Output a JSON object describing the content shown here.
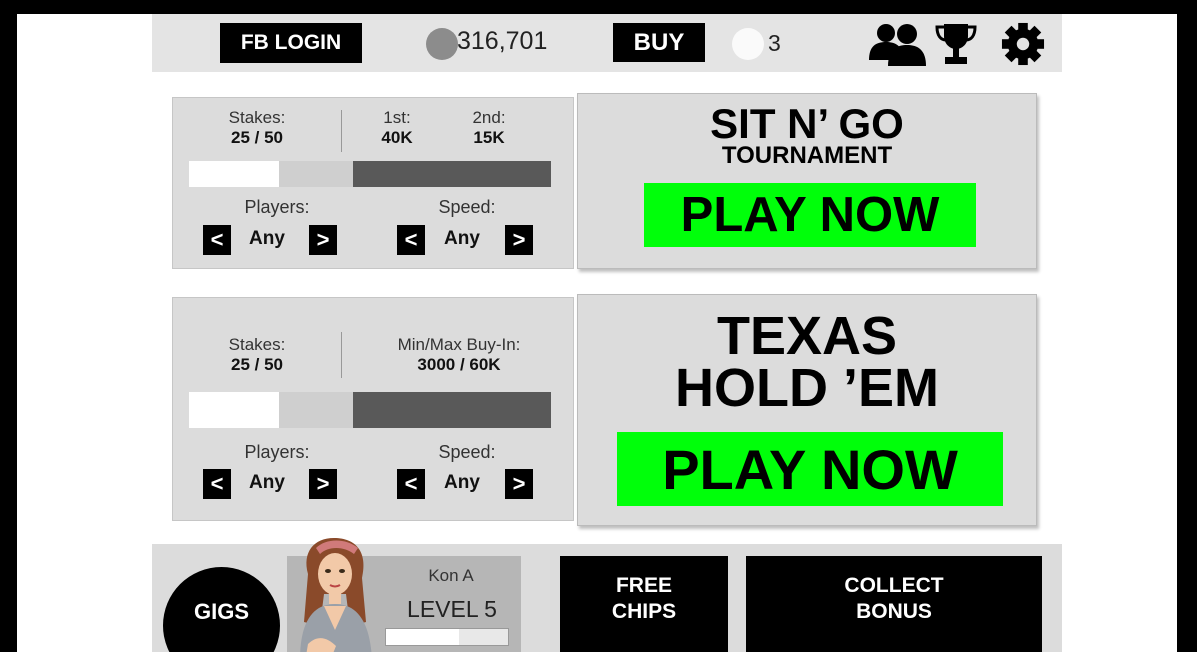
{
  "topbar": {
    "fb_login": "FB LOGIN",
    "chips": "316,701",
    "buy": "BUY",
    "tickets": "3",
    "icons": [
      "friends-icon",
      "trophy-icon",
      "gear-icon"
    ]
  },
  "sit_n_go": {
    "stakes_label": "Stakes:",
    "stakes_value": "25 / 50",
    "first_label": "1st:",
    "first_value": "40K",
    "second_label": "2nd:",
    "second_value": "15K",
    "slider_level": 0.45,
    "players_label": "Players:",
    "players_value": "Any",
    "speed_label": "Speed:",
    "speed_value": "Any",
    "prev_arrow": "<",
    "next_arrow": ">",
    "title_main": "SIT N’ GO",
    "title_sub": "TOURNAMENT",
    "play": "PLAY NOW"
  },
  "texas": {
    "stakes_label": "Stakes:",
    "stakes_value": "25 / 50",
    "buyin_label": "Min/Max Buy-In:",
    "buyin_value": "3000 / 60K",
    "slider_level": 0.45,
    "players_label": "Players:",
    "players_value": "Any",
    "speed_label": "Speed:",
    "speed_value": "Any",
    "prev_arrow": "<",
    "next_arrow": ">",
    "title_line1": "TEXAS",
    "title_line2": "HOLD ’EM",
    "play": "PLAY NOW"
  },
  "bottombar": {
    "gigs": "GIGS",
    "player_name": "Kon A",
    "level": "LEVEL 5",
    "level_progress": 0.6,
    "free_chips_line1": "FREE",
    "free_chips_line2": "CHIPS",
    "collect_line1": "COLLECT",
    "collect_line2": "BONUS"
  },
  "colors": {
    "play_green": "#00ff0a",
    "panel_gray": "#dcdcdc",
    "black": "#000000"
  }
}
